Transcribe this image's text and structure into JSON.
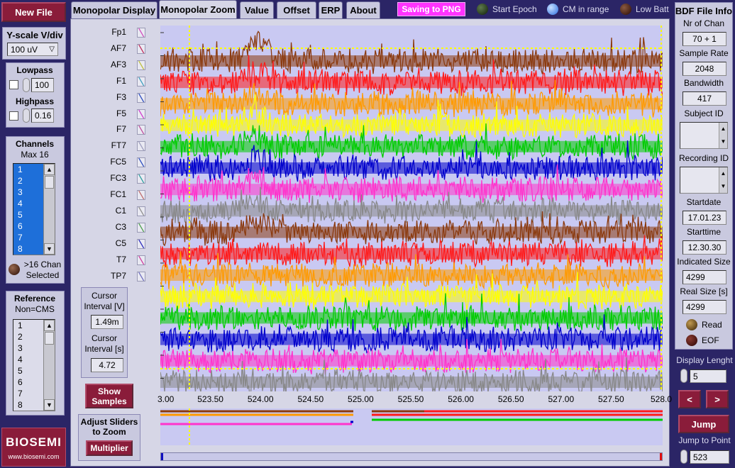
{
  "left": {
    "new_file": "New File",
    "yscale_label": "Y-scale V/div",
    "yscale_value": "100 uV",
    "lowpass_label": "Lowpass",
    "lowpass_value": "100",
    "highpass_label": "Highpass",
    "highpass_value": "0.16",
    "channels_label": "Channels",
    "channels_max": "Max 16",
    "channel_items": [
      "1",
      "2",
      "3",
      "4",
      "5",
      "6",
      "7",
      "8"
    ],
    "over16_line1": ">16 Chan",
    "over16_line2": "Selected",
    "reference_label": "Reference",
    "reference_value": "Non=CMS",
    "reference_items": [
      "1",
      "2",
      "3",
      "4",
      "5",
      "6",
      "7",
      "8"
    ],
    "logo": "BIOSEMI",
    "website": "www.biosemi.com"
  },
  "tabs": [
    "Monopolar Display",
    "Monopolar Zoom",
    "Value",
    "Offset",
    "ERP",
    "About"
  ],
  "active_tab": "Monopolar Zoom",
  "top": {
    "saving": "Saving to PNG",
    "start_epoch": "Start Epoch",
    "cm_in_range": "CM in range",
    "low_batt": "Low Batt"
  },
  "channels": [
    "Fp1",
    "AF7",
    "AF3",
    "F1",
    "F3",
    "F5",
    "F7",
    "FT7",
    "FC5",
    "FC3",
    "FC1",
    "C1",
    "C3",
    "C5",
    "T7",
    "TP7"
  ],
  "cursor": {
    "interval_v_label1": "Cursor",
    "interval_v_label2": "Interval [V]",
    "interval_v_value": "1.49m",
    "interval_s_label1": "Cursor",
    "interval_s_label2": "Interval [s]",
    "interval_s_value": "4.72"
  },
  "show_samples": "Show Samples",
  "adjust": {
    "line1": "Adjust Sliders",
    "line2": "to Zoom",
    "multiplier": "Multiplier"
  },
  "x_ticks": [
    "3.00",
    "523.50",
    "524.00",
    "524.50",
    "525.00",
    "525.50",
    "526.00",
    "526.50",
    "527.00",
    "527.50",
    "528.0"
  ],
  "trace_colors": [
    "#8b3a0e",
    "#ff1a1a",
    "#ff9a00",
    "#ffff00",
    "#00cc00",
    "#0000cc",
    "#ff33cc",
    "#888888"
  ],
  "right": {
    "title": "BDF File Info",
    "nr_chan_label": "Nr of Chan",
    "nr_chan_value": "70 + 1",
    "sample_rate_label": "Sample Rate",
    "sample_rate_value": "2048",
    "bandwidth_label": "Bandwidth",
    "bandwidth_value": "417",
    "subject_id_label": "Subject ID",
    "recording_id_label": "Recording ID",
    "startdate_label": "Startdate",
    "startdate_value": "17.01.23",
    "starttime_label": "Starttime",
    "starttime_value": "12.30.30",
    "indicated_size_label": "Indicated Size",
    "indicated_size_value": "4299",
    "real_size_label": "Real Size [s]",
    "real_size_value": "4299",
    "read_label": "Read",
    "eof_label": "EOF",
    "display_length_label": "Display Lenght",
    "display_length_value": "5",
    "prev": "<",
    "next": ">",
    "jump": "Jump",
    "jump_to_point_label": "Jump to Point",
    "jump_to_point_value": "523"
  }
}
